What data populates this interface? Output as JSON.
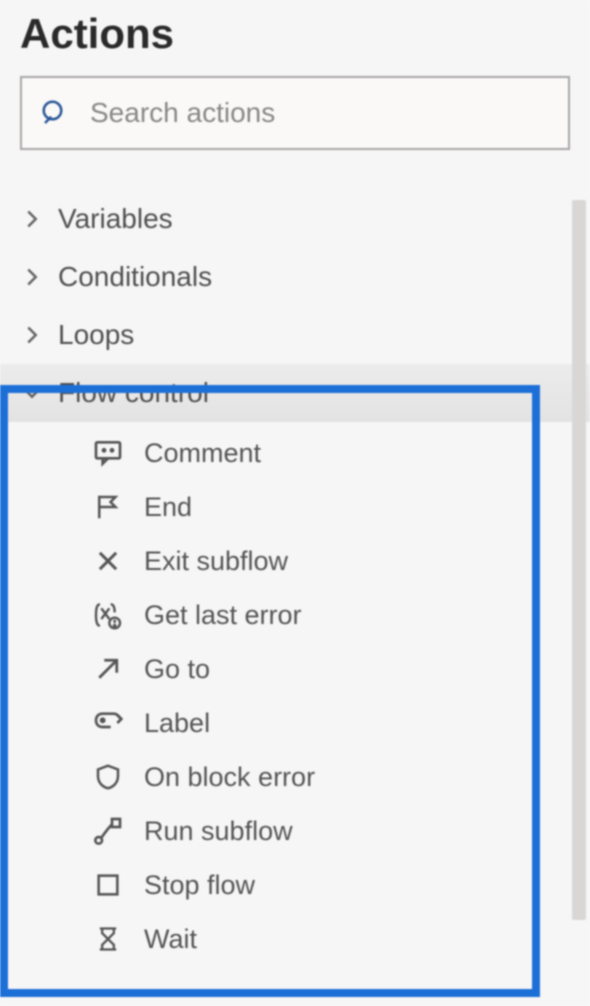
{
  "panel": {
    "title": "Actions"
  },
  "search": {
    "placeholder": "Search actions",
    "value": ""
  },
  "groups": [
    {
      "label": "Variables",
      "expanded": false,
      "icon": "chevron-right-icon"
    },
    {
      "label": "Conditionals",
      "expanded": false,
      "icon": "chevron-right-icon"
    },
    {
      "label": "Loops",
      "expanded": false,
      "icon": "chevron-right-icon"
    },
    {
      "label": "Flow control",
      "expanded": true,
      "icon": "chevron-down-icon",
      "items": [
        {
          "label": "Comment",
          "icon": "comment-icon"
        },
        {
          "label": "End",
          "icon": "flag-icon"
        },
        {
          "label": "Exit subflow",
          "icon": "close-icon"
        },
        {
          "label": "Get last error",
          "icon": "variable-error-icon"
        },
        {
          "label": "Go to",
          "icon": "arrow-up-right-icon"
        },
        {
          "label": "Label",
          "icon": "tag-icon"
        },
        {
          "label": "On block error",
          "icon": "shield-icon"
        },
        {
          "label": "Run subflow",
          "icon": "subflow-icon"
        },
        {
          "label": "Stop flow",
          "icon": "stop-icon"
        },
        {
          "label": "Wait",
          "icon": "hourglass-icon"
        }
      ]
    }
  ],
  "colors": {
    "highlight": "#1d6fd8",
    "iconStroke": "#555"
  }
}
